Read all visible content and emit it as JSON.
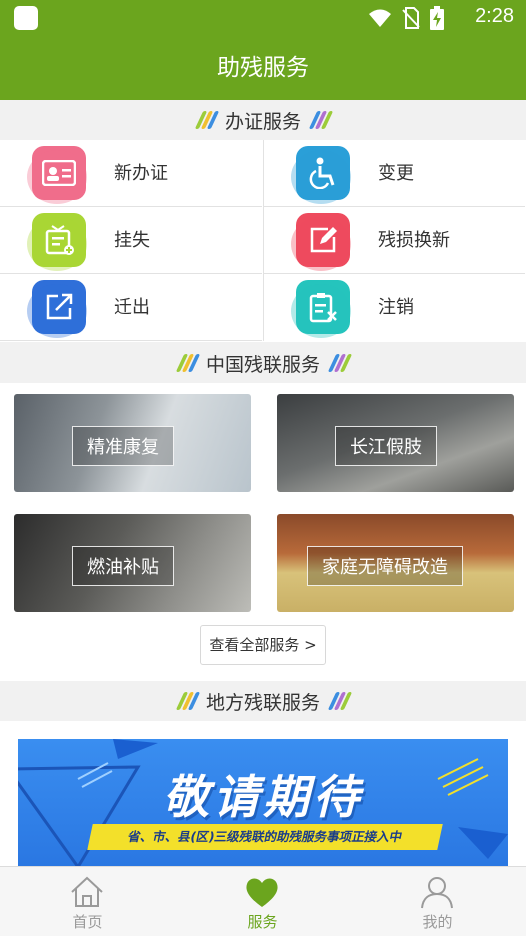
{
  "status_bar": {
    "time": "2:28",
    "icons": [
      "wifi-icon",
      "no-sim-icon",
      "battery-charging-icon"
    ]
  },
  "title_bar": {
    "title": "助残服务"
  },
  "certificate_section": {
    "heading": "办证服务",
    "items": [
      {
        "label": "新办证",
        "icon": "id-card-icon",
        "color": "#f06d8b"
      },
      {
        "label": "变更",
        "icon": "wheelchair-icon",
        "color": "#2a9fd8"
      },
      {
        "label": "挂失",
        "icon": "report-loss-icon",
        "color": "#a9d635"
      },
      {
        "label": "残损换新",
        "icon": "edit-icon",
        "color": "#ee4b5e"
      },
      {
        "label": "迁出",
        "icon": "move-out-icon",
        "color": "#2f6fd9"
      },
      {
        "label": "注销",
        "icon": "cancel-document-icon",
        "color": "#25c4bd"
      }
    ]
  },
  "cdpf_section": {
    "heading": "中国残联服务",
    "cards": [
      {
        "label": "精准康复",
        "image": "doctor-stethoscope-photo"
      },
      {
        "label": "长江假肢",
        "image": "prosthetic-leg-runner-photo"
      },
      {
        "label": "燃油补贴",
        "image": "fuel-nozzle-photo"
      },
      {
        "label": "家庭无障碍改造",
        "image": "house-photo"
      }
    ],
    "view_all": "查看全部服务 >"
  },
  "local_section": {
    "heading": "地方残联服务",
    "banner_title": "敬请期待",
    "banner_subtitle": "省、市、县(区)三级残联的助残服务事项正接入中"
  },
  "tab_bar": {
    "tabs": [
      {
        "label": "首页",
        "icon": "home-icon",
        "active": false
      },
      {
        "label": "服务",
        "icon": "heart-icon",
        "active": true
      },
      {
        "label": "我的",
        "icon": "user-icon",
        "active": false
      }
    ],
    "active_color": "#6ba51e",
    "inactive_color": "#9a9a9a"
  },
  "colors": {
    "brand_green": "#6ba51e"
  }
}
